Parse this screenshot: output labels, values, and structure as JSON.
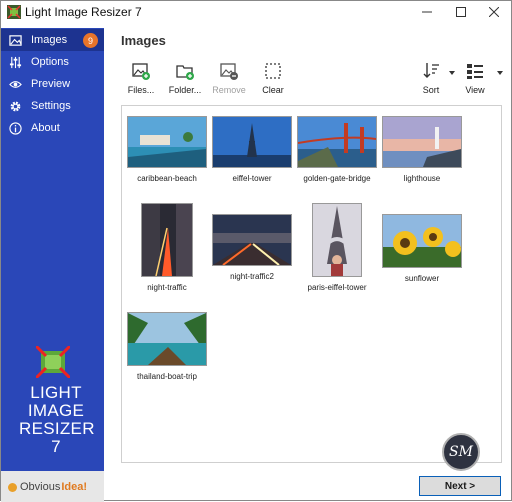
{
  "window": {
    "title": "Light Image Resizer 7"
  },
  "sidebar": {
    "items": [
      {
        "label": "Images",
        "icon": "images-icon",
        "badge": "9",
        "active": true
      },
      {
        "label": "Options",
        "icon": "sliders-icon"
      },
      {
        "label": "Preview",
        "icon": "eye-icon"
      },
      {
        "label": "Settings",
        "icon": "gear-icon"
      },
      {
        "label": "About",
        "icon": "info-icon"
      }
    ],
    "logo_lines": [
      "LIGHT",
      "IMAGE",
      "RESIZER",
      "7"
    ],
    "company": {
      "prefix": "Obvious",
      "suffix": "Idea!"
    }
  },
  "main": {
    "title": "Images",
    "toolbar": {
      "files": "Files...",
      "folder": "Folder...",
      "remove": "Remove",
      "clear": "Clear",
      "sort": "Sort",
      "view": "View"
    },
    "images": [
      {
        "name": "caribbean-beach"
      },
      {
        "name": "eiffel-tower"
      },
      {
        "name": "golden-gate-bridge"
      },
      {
        "name": "lighthouse"
      },
      {
        "name": "night-traffic"
      },
      {
        "name": "night-traffic2"
      },
      {
        "name": "paris-eiffel-tower"
      },
      {
        "name": "sunflower"
      },
      {
        "name": "thailand-boat-trip"
      }
    ],
    "next": "Next >"
  },
  "colors": {
    "sidebar": "#2a47b8",
    "sidebar_active": "#1d3390",
    "badge": "#e8742a",
    "accent_border": "#0a60b8"
  }
}
